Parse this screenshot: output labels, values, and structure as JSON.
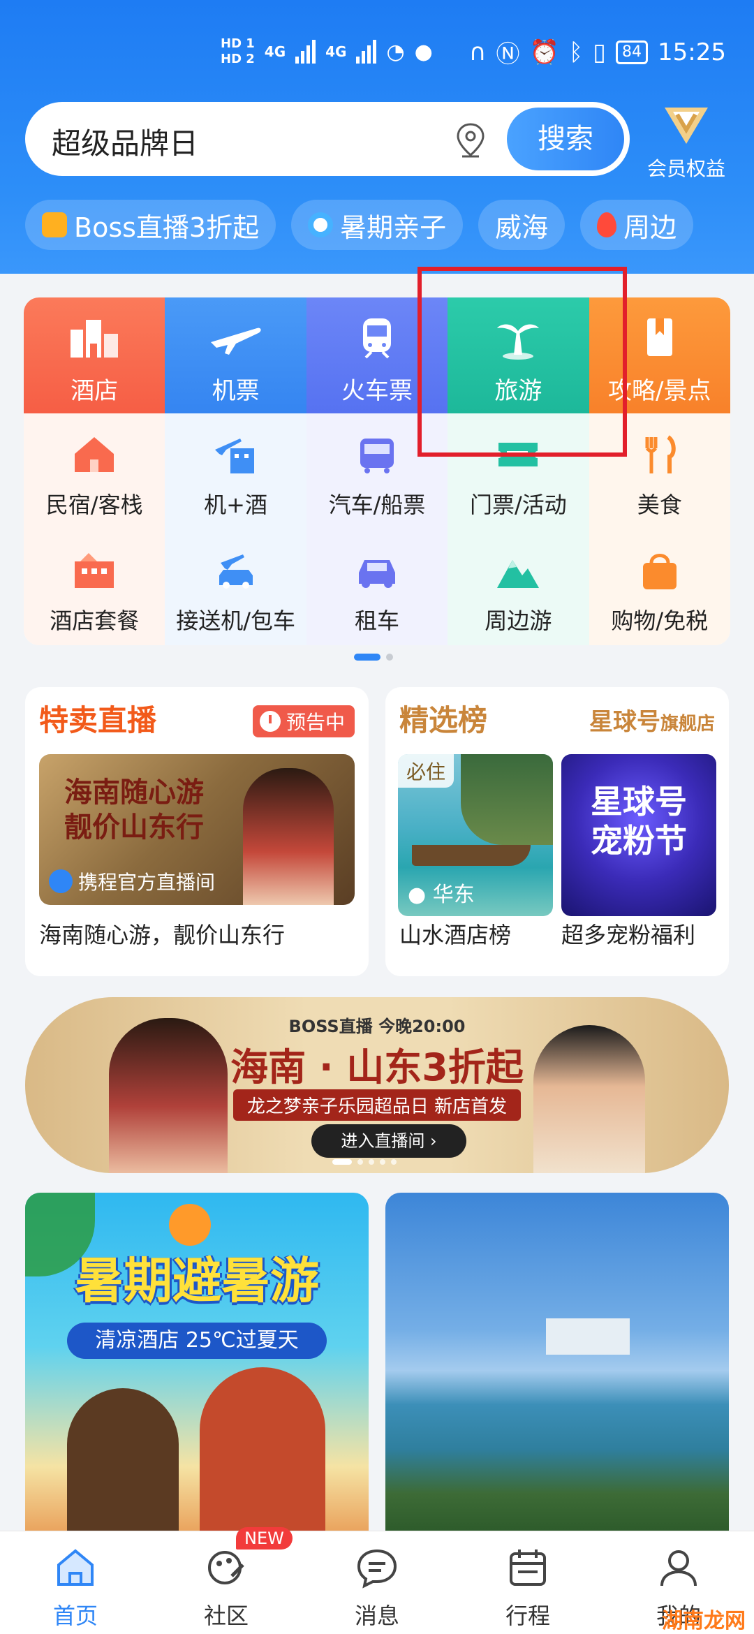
{
  "status_bar": {
    "left_badges": [
      "HD 1",
      "HD 2"
    ],
    "network": [
      "4G",
      "4G"
    ],
    "battery": "84",
    "time": "15:25"
  },
  "search": {
    "text": "超级品牌日",
    "button": "搜索"
  },
  "member": {
    "label": "会员权益"
  },
  "quick_tags": [
    {
      "label": "Boss直播3折起",
      "icon": "video-icon"
    },
    {
      "label": "暑期亲子",
      "icon": "lifebuoy-icon"
    },
    {
      "label": "威海",
      "icon": ""
    },
    {
      "label": "周边",
      "icon": "flame-icon"
    }
  ],
  "grid": {
    "row1": [
      {
        "label": "酒店",
        "icon": "hotel-icon",
        "color": "#f96a4e"
      },
      {
        "label": "机票",
        "icon": "plane-icon",
        "color": "#3f8ff5"
      },
      {
        "label": "火车票",
        "icon": "train-icon",
        "color": "#5f7af5"
      },
      {
        "label": "旅游",
        "icon": "palm-tree-icon",
        "color": "#23c0a2"
      },
      {
        "label": "攻略/景点",
        "icon": "guide-book-icon",
        "color": "#fb8b2d"
      }
    ],
    "row2": [
      {
        "label": "民宿/客栈",
        "icon": "house-icon",
        "color": "#f96a4e"
      },
      {
        "label": "机+酒",
        "icon": "plane-hotel-icon",
        "color": "#3f8ff5"
      },
      {
        "label": "汽车/船票",
        "icon": "bus-icon",
        "color": "#6a73f0"
      },
      {
        "label": "门票/活动",
        "icon": "ticket-icon",
        "color": "#23c0a2"
      },
      {
        "label": "美食",
        "icon": "fork-knife-icon",
        "color": "#fb8b2d"
      }
    ],
    "row3": [
      {
        "label": "酒店套餐",
        "icon": "hotel-package-icon",
        "color": "#f96a4e"
      },
      {
        "label": "接送机/包车",
        "icon": "car-plane-icon",
        "color": "#3f8ff5"
      },
      {
        "label": "租车",
        "icon": "car-icon",
        "color": "#6a73f0"
      },
      {
        "label": "周边游",
        "icon": "mountain-icon",
        "color": "#23c0a2"
      },
      {
        "label": "购物/免税",
        "icon": "shopping-bag-icon",
        "color": "#fb8b2d"
      }
    ]
  },
  "promo_live": {
    "title": "特卖直播",
    "notice": "预告中",
    "image_headline_1": "海南随心游",
    "image_headline_2": "靓价山东行",
    "caption": "携程官方直播间",
    "desc": "海南随心游，靓价山东行"
  },
  "promo_rank": {
    "title": "精选榜",
    "brand": "星球号",
    "brand_suffix": "旗舰店",
    "card1_badge": "必住",
    "card1_location": "华东",
    "card1_desc": "山水酒店榜",
    "card2_word_1": "星球号",
    "card2_word_2": "宠粉节",
    "card2_desc": "超多宠粉福利"
  },
  "banner": {
    "top": "BOSS直播 今晚20:00",
    "title": "海南 · 山东3折起",
    "sub": "龙之梦亲子乐园超品日  新店首发",
    "button": "进入直播间"
  },
  "card_summer": {
    "title": "暑期避暑游",
    "sub": "清凉酒店 25℃过夏天"
  },
  "nav": [
    {
      "label": "首页",
      "icon": "home-icon",
      "active": true
    },
    {
      "label": "社区",
      "icon": "community-icon",
      "badge": "NEW"
    },
    {
      "label": "消息",
      "icon": "message-icon"
    },
    {
      "label": "行程",
      "icon": "calendar-icon"
    },
    {
      "label": "我的",
      "icon": "user-icon"
    }
  ],
  "watermark": "湖南龙网",
  "colors": {
    "primary": "#2f86f6",
    "highlight": "#e21f2b"
  }
}
